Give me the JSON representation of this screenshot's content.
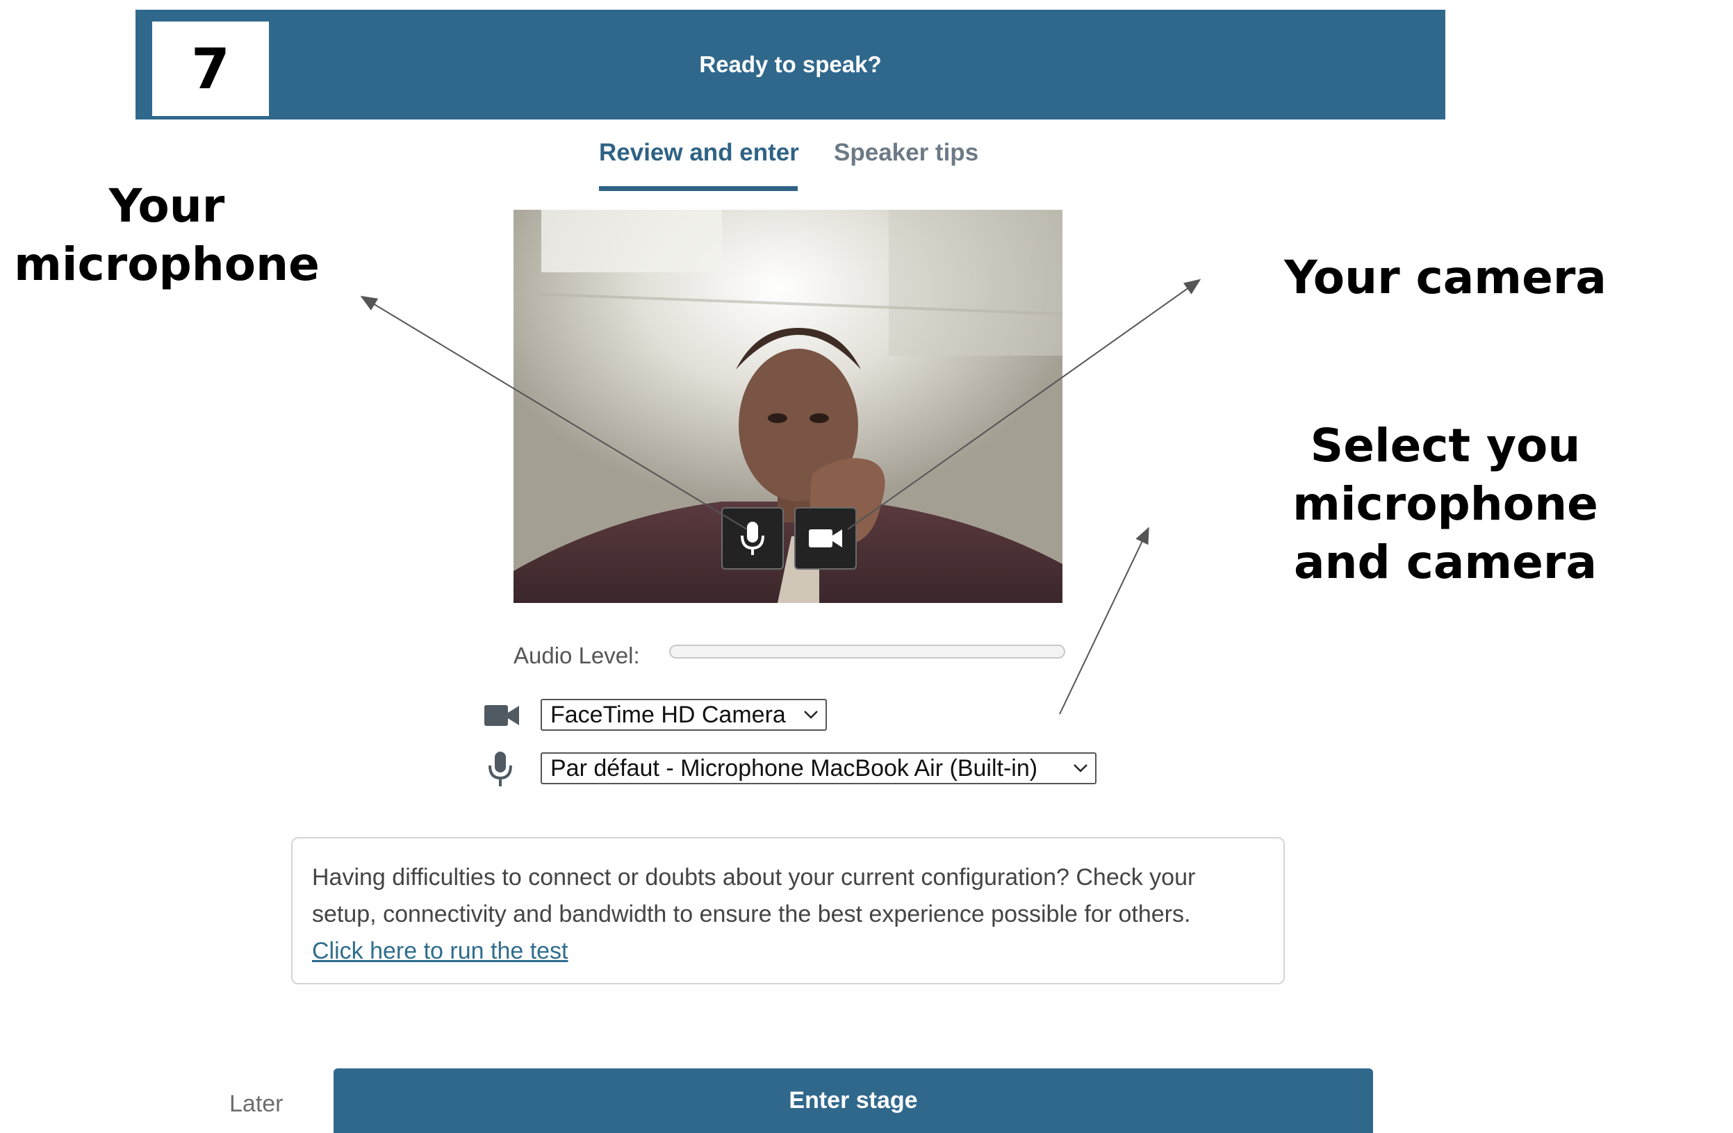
{
  "step_number": "7",
  "header": {
    "title": "Ready to speak?"
  },
  "tabs": [
    {
      "label": "Review and enter",
      "active": true
    },
    {
      "label": "Speaker tips",
      "active": false
    }
  ],
  "audio": {
    "label": "Audio Level:"
  },
  "devices": {
    "camera_selected": "FaceTime HD Camera",
    "microphone_selected": "Par défaut - Microphone MacBook Air (Built-in)"
  },
  "help": {
    "text": "Having difficulties to connect or doubts about your current configuration? Check your setup, connectivity and bandwidth to ensure the best experience possible for others.",
    "link": "Click here to run the test"
  },
  "footer": {
    "later_label": "Later",
    "enter_label": "Enter stage"
  },
  "annotations": {
    "microphone": [
      "Your",
      "microphone"
    ],
    "camera": "Your camera",
    "select": [
      "Select you microphone",
      "and camera"
    ]
  },
  "colors": {
    "brand": "#30688c",
    "tab_active": "#2f6284",
    "link": "#2f6d8e"
  },
  "icons": [
    "microphone-icon",
    "camera-icon",
    "chevron-down-icon"
  ]
}
